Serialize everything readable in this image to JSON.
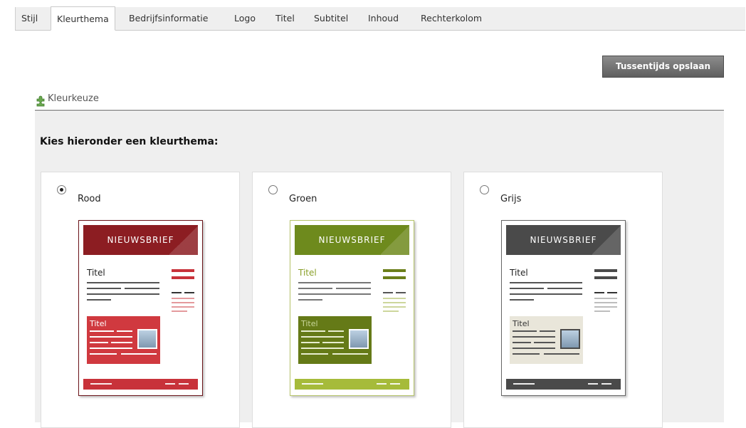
{
  "tabs": [
    {
      "label": "Stijl",
      "active": false
    },
    {
      "label": "Kleurthema",
      "active": true
    },
    {
      "label": "Bedrijfsinformatie",
      "active": false
    },
    {
      "label": "Logo",
      "active": false
    },
    {
      "label": "Titel",
      "active": false
    },
    {
      "label": "Subtitel",
      "active": false
    },
    {
      "label": "Inhoud",
      "active": false
    },
    {
      "label": "Rechterkolom",
      "active": false
    }
  ],
  "save_button": "Tussentijds opslaan",
  "section": {
    "title": "Kleurkeuze",
    "icon": "puzzle-icon"
  },
  "prompt": "Kies hieronder een kleurthema:",
  "themes": [
    {
      "name": "Rood",
      "selected": true,
      "preview": {
        "masthead": "NIEUWSBRIEF",
        "title": "Titel",
        "box_title": "Titel"
      },
      "colors": {
        "main": "#8c1d22",
        "accent": "#c8323a",
        "box": "#d0393f",
        "title_text": "#222222",
        "box_text": "#ffffff"
      }
    },
    {
      "name": "Groen",
      "selected": false,
      "preview": {
        "masthead": "NIEUWSBRIEF",
        "title": "Titel",
        "box_title": "Titel"
      },
      "colors": {
        "main": "#6e8a1d",
        "accent": "#6b7f1a",
        "box": "#657a17",
        "title_text": "#8aa02a",
        "box_text": "#c9d79a"
      }
    },
    {
      "name": "Grijs",
      "selected": false,
      "preview": {
        "masthead": "NIEUWSBRIEF",
        "title": "Titel",
        "box_title": "Titel"
      },
      "colors": {
        "main": "#4a4a4a",
        "accent": "#4a4a4a",
        "box": "#e9e6da",
        "title_text": "#222222",
        "box_text": "#333333"
      }
    }
  ]
}
